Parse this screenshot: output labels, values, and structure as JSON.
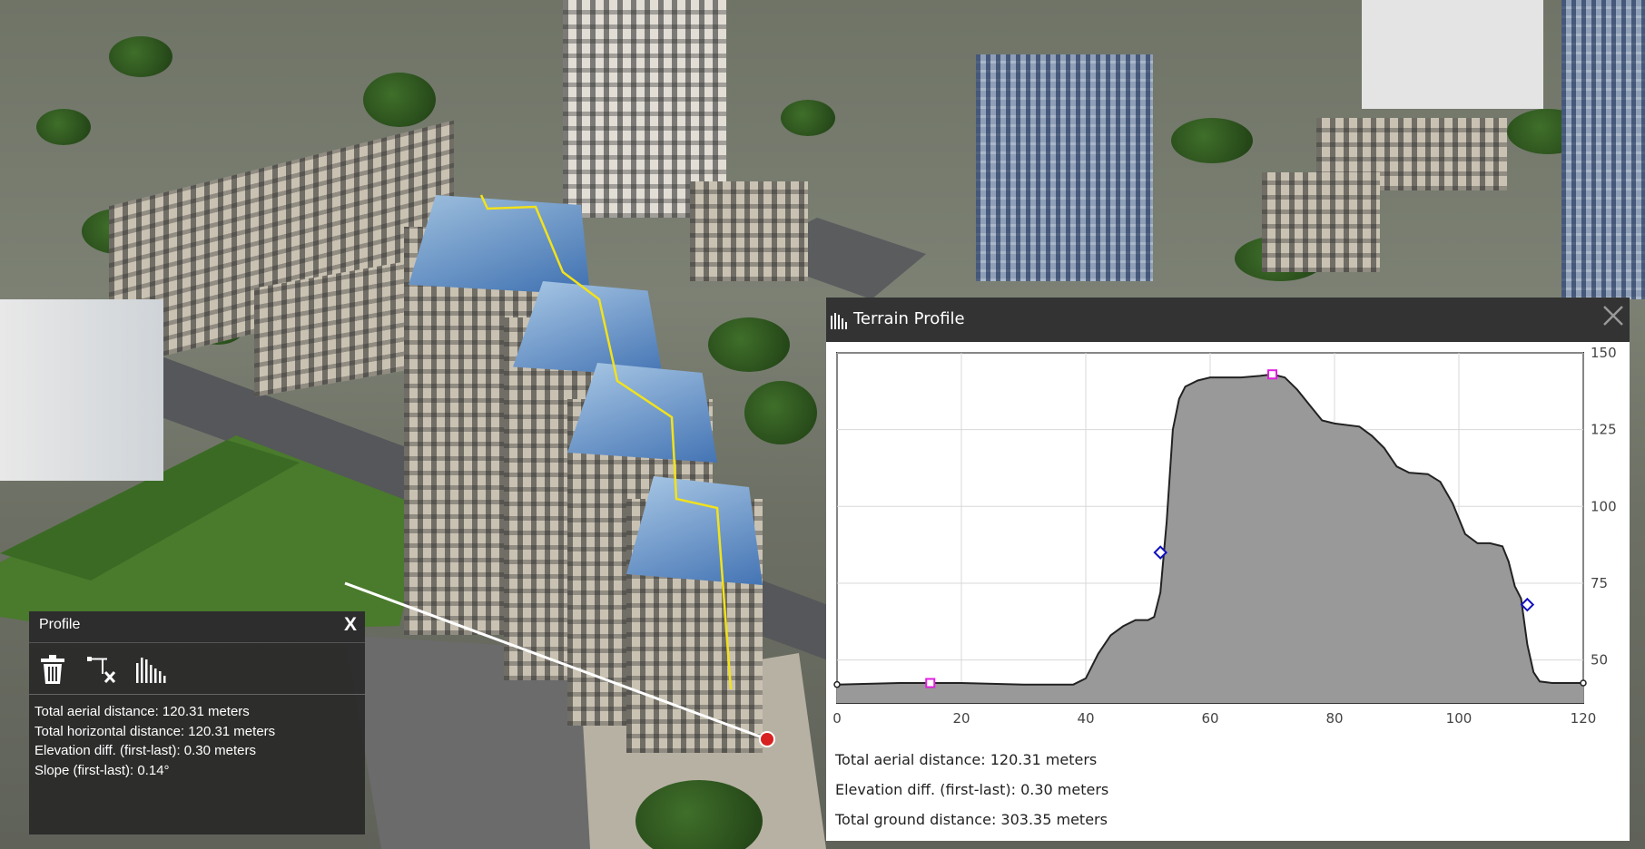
{
  "profile_panel": {
    "title": "Profile",
    "close_label": "X",
    "tools": [
      "trash-icon",
      "line-delete-icon",
      "terrain-chart-icon"
    ],
    "stats": [
      "Total aerial distance: 120.31 meters",
      "Total horizontal distance: 120.31 meters",
      "Elevation diff. (first-last): 0.30 meters",
      "Slope (first-last): 0.14°"
    ]
  },
  "terrain_panel": {
    "title": "Terrain Profile",
    "stats": [
      "Total aerial distance: 120.31 meters",
      "Elevation diff. (first-last): 0.30 meters",
      "Total ground distance: 303.35 meters"
    ]
  },
  "chart_data": {
    "type": "area",
    "xlim": [
      0,
      120
    ],
    "ylim": [
      36,
      150
    ],
    "xticks": [
      0,
      20,
      40,
      60,
      80,
      100,
      120
    ],
    "yticks": [
      50,
      75,
      100,
      125,
      150
    ],
    "grid": true,
    "fill_color": "#999999",
    "line_color": "#222222",
    "profile": [
      [
        0,
        42
      ],
      [
        10,
        42.5
      ],
      [
        20,
        42.5
      ],
      [
        30,
        42
      ],
      [
        38,
        42
      ],
      [
        40,
        44
      ],
      [
        42,
        52
      ],
      [
        44,
        58
      ],
      [
        46,
        61
      ],
      [
        48,
        63
      ],
      [
        50,
        63
      ],
      [
        51,
        64
      ],
      [
        52,
        72
      ],
      [
        53,
        95
      ],
      [
        54,
        125
      ],
      [
        55,
        135
      ],
      [
        56,
        139
      ],
      [
        58,
        141
      ],
      [
        60,
        142
      ],
      [
        65,
        142
      ],
      [
        68,
        142.5
      ],
      [
        70,
        143
      ],
      [
        72,
        142
      ],
      [
        74,
        138
      ],
      [
        76,
        133
      ],
      [
        78,
        128
      ],
      [
        80,
        127
      ],
      [
        84,
        126
      ],
      [
        86,
        123
      ],
      [
        88,
        119
      ],
      [
        90,
        113
      ],
      [
        92,
        111
      ],
      [
        95,
        110.5
      ],
      [
        97,
        108
      ],
      [
        99,
        101
      ],
      [
        101,
        91
      ],
      [
        103,
        88
      ],
      [
        105,
        88
      ],
      [
        107,
        87
      ],
      [
        108,
        82
      ],
      [
        109,
        74
      ],
      [
        110,
        70
      ],
      [
        111,
        55
      ],
      [
        112,
        46
      ],
      [
        113,
        43
      ],
      [
        115,
        42.5
      ],
      [
        120,
        42.5
      ]
    ],
    "markers": [
      {
        "x": 0,
        "y": 42,
        "shape": "circle",
        "color": "#222222"
      },
      {
        "x": 15,
        "y": 42.5,
        "shape": "square",
        "color": "#e020e0"
      },
      {
        "x": 52,
        "y": 85,
        "shape": "diamond",
        "color": "#1010c0"
      },
      {
        "x": 70,
        "y": 143,
        "shape": "square",
        "color": "#e020e0"
      },
      {
        "x": 111,
        "y": 68,
        "shape": "diamond",
        "color": "#1010c0"
      },
      {
        "x": 120,
        "y": 42.5,
        "shape": "circle",
        "color": "#222222"
      }
    ]
  }
}
